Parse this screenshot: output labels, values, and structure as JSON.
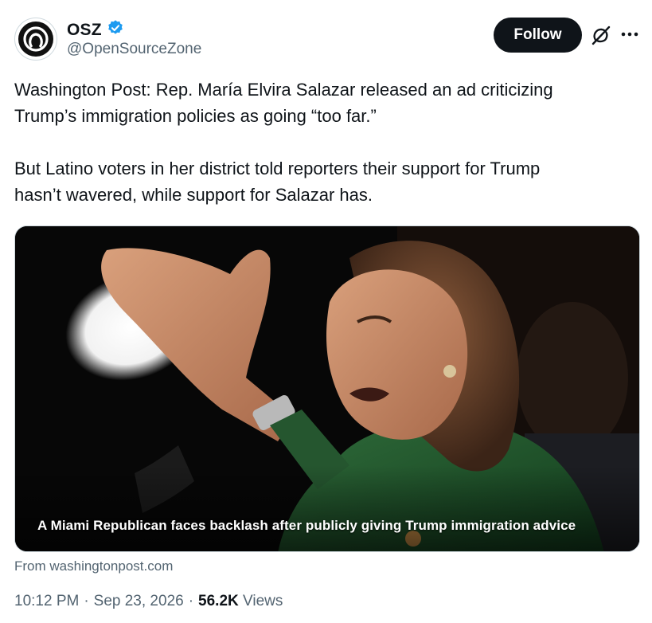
{
  "author": {
    "display_name": "OSZ",
    "handle": "@OpenSourceZone",
    "verified": true,
    "badge_color": "#1d9bf0"
  },
  "actions": {
    "follow_label": "Follow",
    "grok_icon": "grok-icon",
    "more_icon": "more-icon"
  },
  "tweet": {
    "text": "Washington Post: Rep. María Elvira Salazar released an ad criticizing\nTrump’s immigration policies as going “too far.”\n\nBut Latino voters in her district told reporters their support for Trump\nhasn’t wavered, while support for Salazar has."
  },
  "link_card": {
    "caption": "A Miami Republican faces backlash after publicly giving Trump immigration advice",
    "source": "From washingtonpost.com"
  },
  "meta": {
    "time": "10:12 PM",
    "date": "Sep 23, 2026",
    "separator": "·",
    "views_count": "56.2K",
    "views_label": "Views"
  }
}
